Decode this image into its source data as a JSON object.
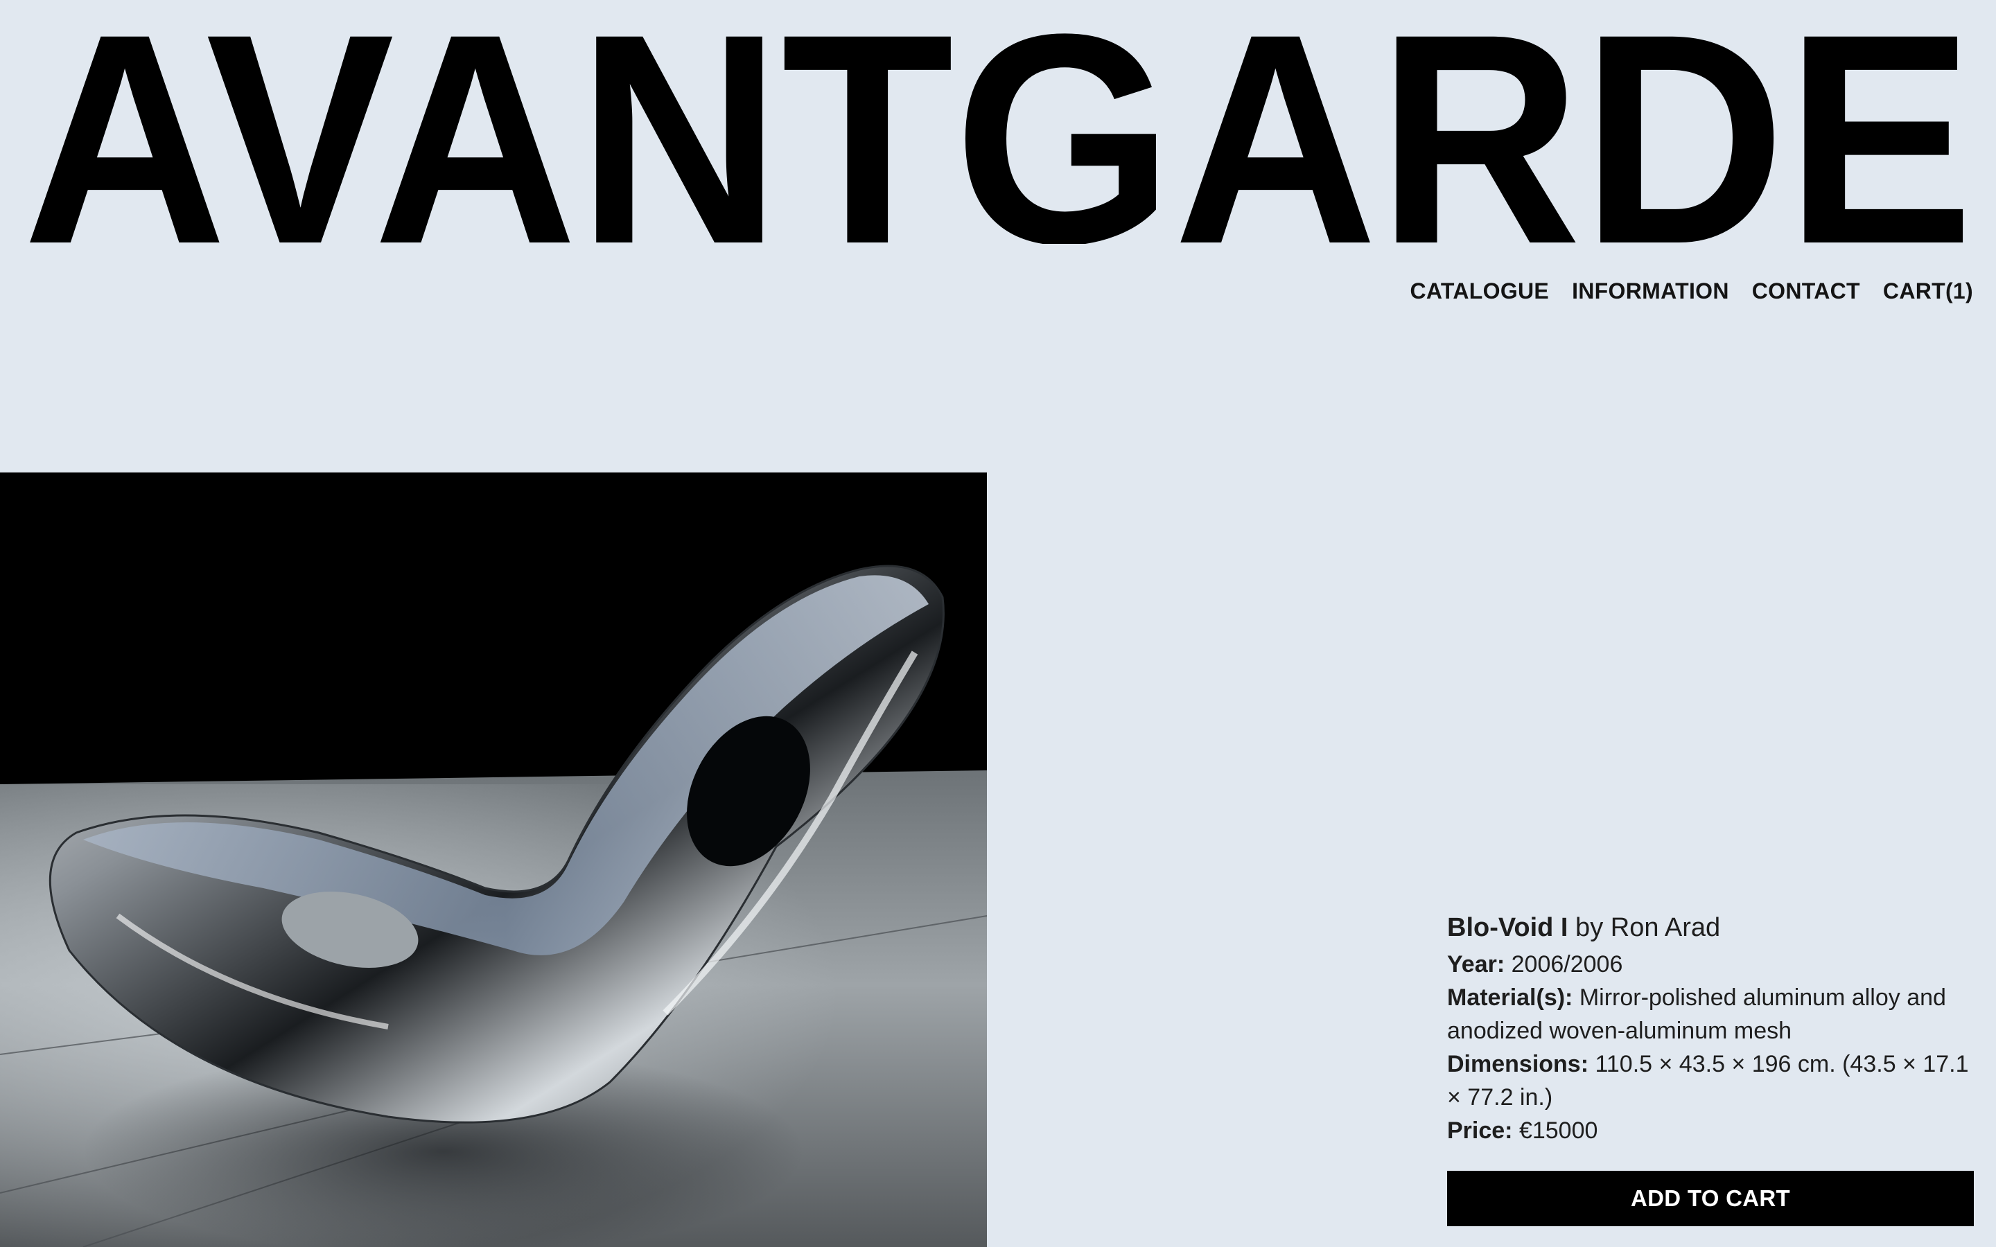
{
  "brand": {
    "name": "AVANTGARDE"
  },
  "nav": {
    "items": [
      {
        "label": "CATALOGUE"
      },
      {
        "label": "INFORMATION"
      },
      {
        "label": "CONTACT"
      },
      {
        "label": "CART(1)"
      }
    ]
  },
  "product": {
    "image_alt_icon": "chaise-lounge-photo",
    "name": "Blo-Void I",
    "by_text": " by Ron Arad",
    "year_label": "Year:",
    "year_value": " 2006/2006",
    "material_label": "Material(s):",
    "material_value": " Mirror-polished aluminum alloy and anodized woven-aluminum mesh",
    "dimensions_label": "Dimensions:",
    "dimensions_value": " 110.5 × 43.5 × 196 cm. (43.5 × 17.1 × 77.2 in.)",
    "price_label": "Price:",
    "price_value": " €15000",
    "add_to_cart_label": "ADD TO CART"
  },
  "colors": {
    "background": "#e1e8f0",
    "text": "#141414",
    "button_bg": "#000000",
    "button_text": "#ffffff"
  }
}
